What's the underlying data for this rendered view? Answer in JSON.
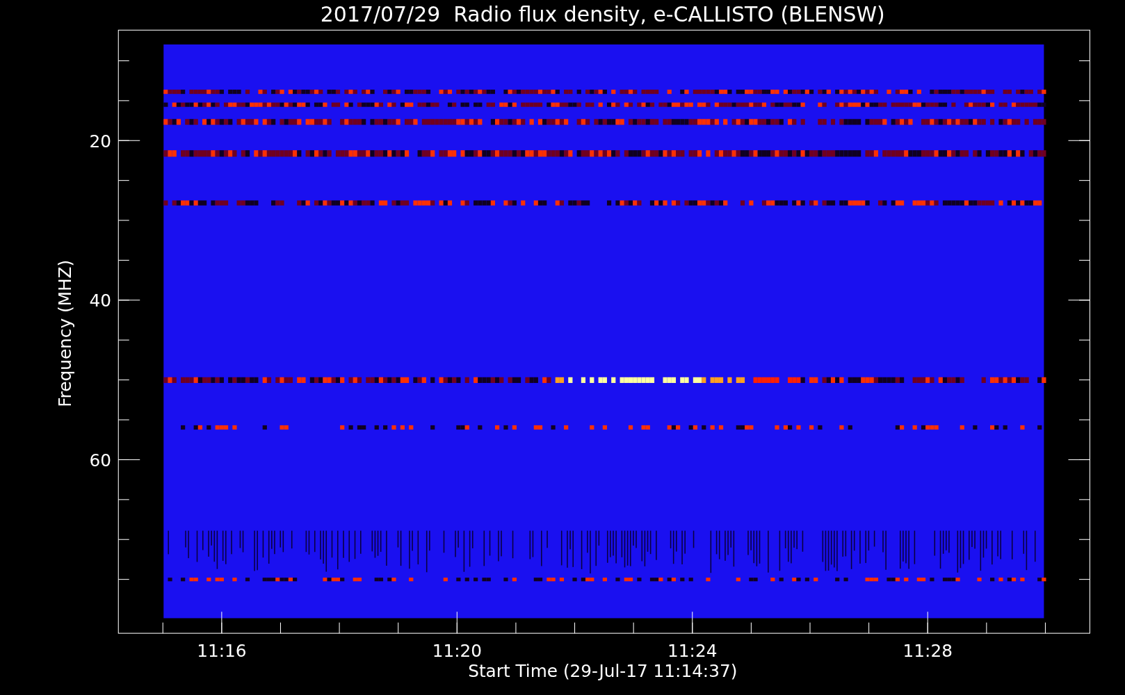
{
  "chart": {
    "title": "2017/07/29  Radio flux density, e-CALLISTO (BLENSW)",
    "ylabel": "Frequency (MHZ)",
    "xlabel": "Start Time (29-Jul-17 11:14:37)",
    "yticklabels": [
      "20",
      "40",
      "60"
    ],
    "xticklabels": [
      "11:16",
      "11:20",
      "11:24",
      "11:28"
    ]
  }
}
